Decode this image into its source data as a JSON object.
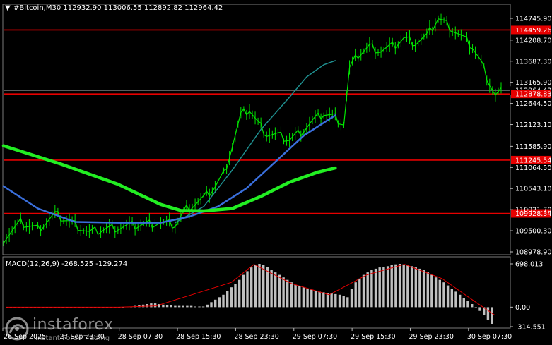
{
  "header": {
    "arrow": "▼",
    "text": "#Bitcoin,M30  112932.90 113006.55 112892.82 112964.42"
  },
  "colors": {
    "background": "#000000",
    "candle": "#00e600",
    "ma_slow": "#22ee22",
    "ma_mid": "#3a6fdc",
    "ma_fast": "#1f8f8f",
    "level": "#e60000",
    "macd_hist": "#c0c0c0",
    "macd_signal": "#e60000",
    "grid": "#3c3c3c"
  },
  "price_axis": {
    "ticks": [
      "114745.90",
      "114208.70",
      "113687.30",
      "113165.90",
      "112644.50",
      "112123.10",
      "111585.90",
      "111064.50",
      "110543.10",
      "110021.70",
      "109500.30",
      "108978.90"
    ],
    "tick_values": [
      114745.9,
      114208.7,
      113687.3,
      113165.9,
      112644.5,
      112123.1,
      111585.9,
      111064.5,
      110543.1,
      110021.7,
      109500.3,
      108978.9
    ]
  },
  "levels": [
    {
      "label": "114459.26",
      "value": 114459.26
    },
    {
      "label": "112878.83",
      "value": 112878.83
    },
    {
      "label": "111245.54",
      "value": 111245.54
    },
    {
      "label": "109928.34",
      "value": 109928.34
    }
  ],
  "current_price": {
    "label": "112964.42",
    "value": 112964.42
  },
  "time_axis": {
    "labels": [
      "26 Sep 2025",
      "27 Sep 23:30",
      "28 Sep 07:30",
      "28 Sep 15:30",
      "28 Sep 23:30",
      "29 Sep 07:30",
      "29 Sep 15:30",
      "29 Sep 23:30",
      "30 Sep 07:30"
    ],
    "positions": [
      0,
      1,
      2,
      3,
      4,
      5,
      6,
      7,
      8
    ]
  },
  "macd": {
    "title": "MACD(12,26,9) -268.525 -129.274",
    "ticks": [
      "698.013",
      "0.00",
      "-314.551"
    ],
    "tick_values": [
      698.013,
      0,
      -314.551
    ]
  },
  "logo": {
    "name": "instaforex",
    "tagline": "Instant Forex Trading"
  },
  "chart_data": {
    "type": "line",
    "symbol": "#Bitcoin",
    "timeframe": "M30",
    "ohlc_last": {
      "open": 112932.9,
      "high": 113006.55,
      "low": 112892.82,
      "close": 112964.42
    },
    "ylim": [
      108978.9,
      114745.9
    ],
    "price_path": [
      [
        0,
        109300
      ],
      [
        6,
        109700
      ],
      [
        12,
        109550
      ],
      [
        18,
        109900
      ],
      [
        24,
        109700
      ],
      [
        30,
        109450
      ],
      [
        36,
        109550
      ],
      [
        42,
        109600
      ],
      [
        48,
        109650
      ],
      [
        54,
        109700
      ],
      [
        60,
        109650
      ],
      [
        64,
        110050
      ],
      [
        70,
        110300
      ],
      [
        74,
        110600
      ],
      [
        77,
        110900
      ],
      [
        80,
        111600
      ],
      [
        83,
        112350
      ],
      [
        86,
        112500
      ],
      [
        89,
        112150
      ],
      [
        92,
        111900
      ],
      [
        96,
        111850
      ],
      [
        100,
        111750
      ],
      [
        104,
        111950
      ],
      [
        108,
        112200
      ],
      [
        112,
        112400
      ],
      [
        116,
        112300
      ],
      [
        119,
        112150
      ],
      [
        121,
        113500
      ],
      [
        124,
        113850
      ],
      [
        128,
        114050
      ],
      [
        132,
        113950
      ],
      [
        136,
        114050
      ],
      [
        140,
        114250
      ],
      [
        144,
        114150
      ],
      [
        148,
        114300
      ],
      [
        152,
        114750
      ],
      [
        156,
        114550
      ],
      [
        160,
        114300
      ],
      [
        164,
        114050
      ],
      [
        167,
        113650
      ],
      [
        170,
        113150
      ],
      [
        172,
        112850
      ],
      [
        174,
        112960
      ]
    ],
    "ma_slow": [
      [
        0,
        111600
      ],
      [
        20,
        111150
      ],
      [
        40,
        110650
      ],
      [
        55,
        110150
      ],
      [
        62,
        110000
      ],
      [
        70,
        109990
      ],
      [
        80,
        110050
      ],
      [
        90,
        110350
      ],
      [
        100,
        110700
      ],
      [
        110,
        110950
      ],
      [
        116,
        111050
      ]
    ],
    "ma_mid": [
      [
        0,
        110600
      ],
      [
        12,
        110050
      ],
      [
        25,
        109720
      ],
      [
        40,
        109700
      ],
      [
        55,
        109700
      ],
      [
        65,
        109850
      ],
      [
        75,
        110100
      ],
      [
        85,
        110550
      ],
      [
        95,
        111200
      ],
      [
        105,
        111850
      ],
      [
        116,
        112350
      ]
    ],
    "ma_fast": [
      [
        60,
        109700
      ],
      [
        70,
        110100
      ],
      [
        80,
        111000
      ],
      [
        90,
        112000
      ],
      [
        100,
        112800
      ],
      [
        106,
        113300
      ],
      [
        112,
        113600
      ],
      [
        116,
        113700
      ]
    ],
    "macd_histogram": [
      0,
      0,
      0,
      0,
      0,
      0,
      0,
      0,
      0,
      0,
      0,
      0,
      0,
      0,
      0,
      0,
      0,
      0,
      0,
      0,
      0,
      0,
      0,
      0,
      0,
      0,
      0,
      0,
      0,
      0,
      5,
      10,
      20,
      30,
      40,
      50,
      60,
      60,
      50,
      40,
      30,
      30,
      20,
      20,
      20,
      20,
      20,
      10,
      10,
      10,
      40,
      80,
      120,
      160,
      200,
      260,
      320,
      380,
      440,
      520,
      580,
      640,
      680,
      698,
      680,
      650,
      600,
      560,
      520,
      480,
      440,
      400,
      360,
      340,
      320,
      300,
      280,
      260,
      250,
      240,
      230,
      220,
      210,
      200,
      180,
      160,
      300,
      400,
      460,
      520,
      560,
      600,
      620,
      640,
      650,
      660,
      680,
      690,
      698,
      690,
      680,
      660,
      640,
      620,
      600,
      560,
      520,
      480,
      440,
      400,
      350,
      300,
      250,
      200,
      150,
      100,
      50,
      0,
      -60,
      -130,
      -200,
      -268
    ],
    "macd_signal": [
      [
        0,
        0
      ],
      [
        30,
        0
      ],
      [
        40,
        20
      ],
      [
        60,
        400
      ],
      [
        66,
        690
      ],
      [
        76,
        380
      ],
      [
        86,
        200
      ],
      [
        96,
        520
      ],
      [
        106,
        690
      ],
      [
        116,
        460
      ],
      [
        124,
        120
      ],
      [
        130,
        -129
      ]
    ]
  }
}
